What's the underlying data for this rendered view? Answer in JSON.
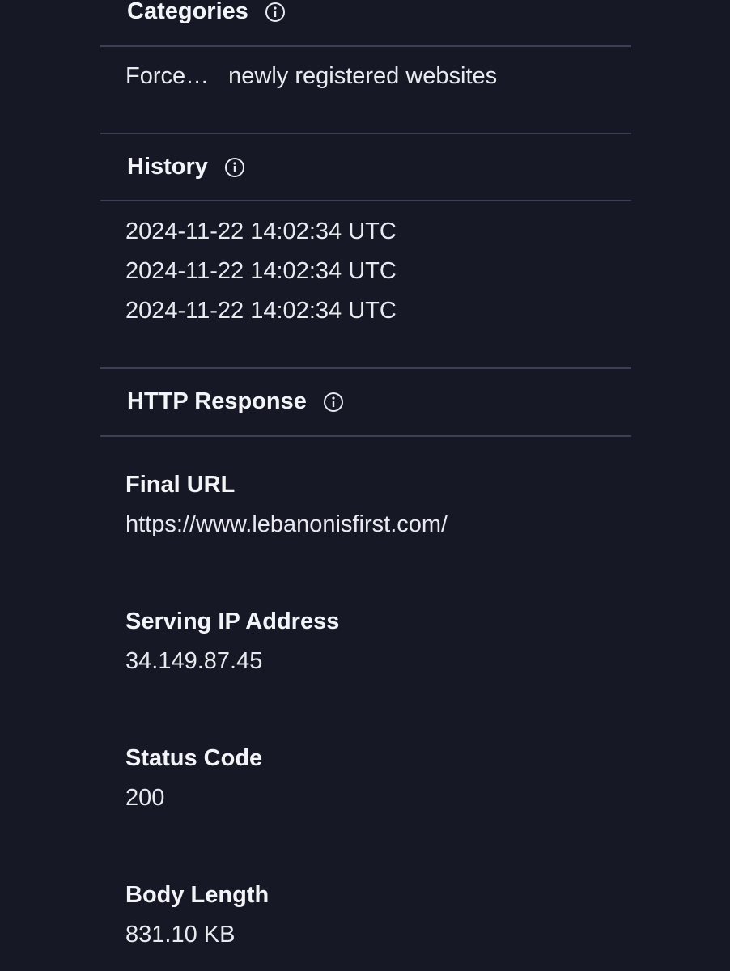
{
  "categories": {
    "title": "Categories",
    "first_truncated": "Force…",
    "second": "newly registered websites"
  },
  "history": {
    "title": "History",
    "entries": [
      "2024-11-22 14:02:34 UTC",
      "2024-11-22 14:02:34 UTC",
      "2024-11-22 14:02:34 UTC"
    ]
  },
  "http_response": {
    "title": "HTTP Response",
    "fields": [
      {
        "label": "Final URL",
        "value": "https://www.lebanonisfirst.com/"
      },
      {
        "label": "Serving IP Address",
        "value": "34.149.87.45"
      },
      {
        "label": "Status Code",
        "value": "200"
      },
      {
        "label": "Body Length",
        "value": "831.10 KB"
      }
    ]
  },
  "icons": {
    "info": "info-circle-icon"
  },
  "colors": {
    "background": "#171825",
    "divider": "#3a4157",
    "text": "#e9eaf0"
  }
}
